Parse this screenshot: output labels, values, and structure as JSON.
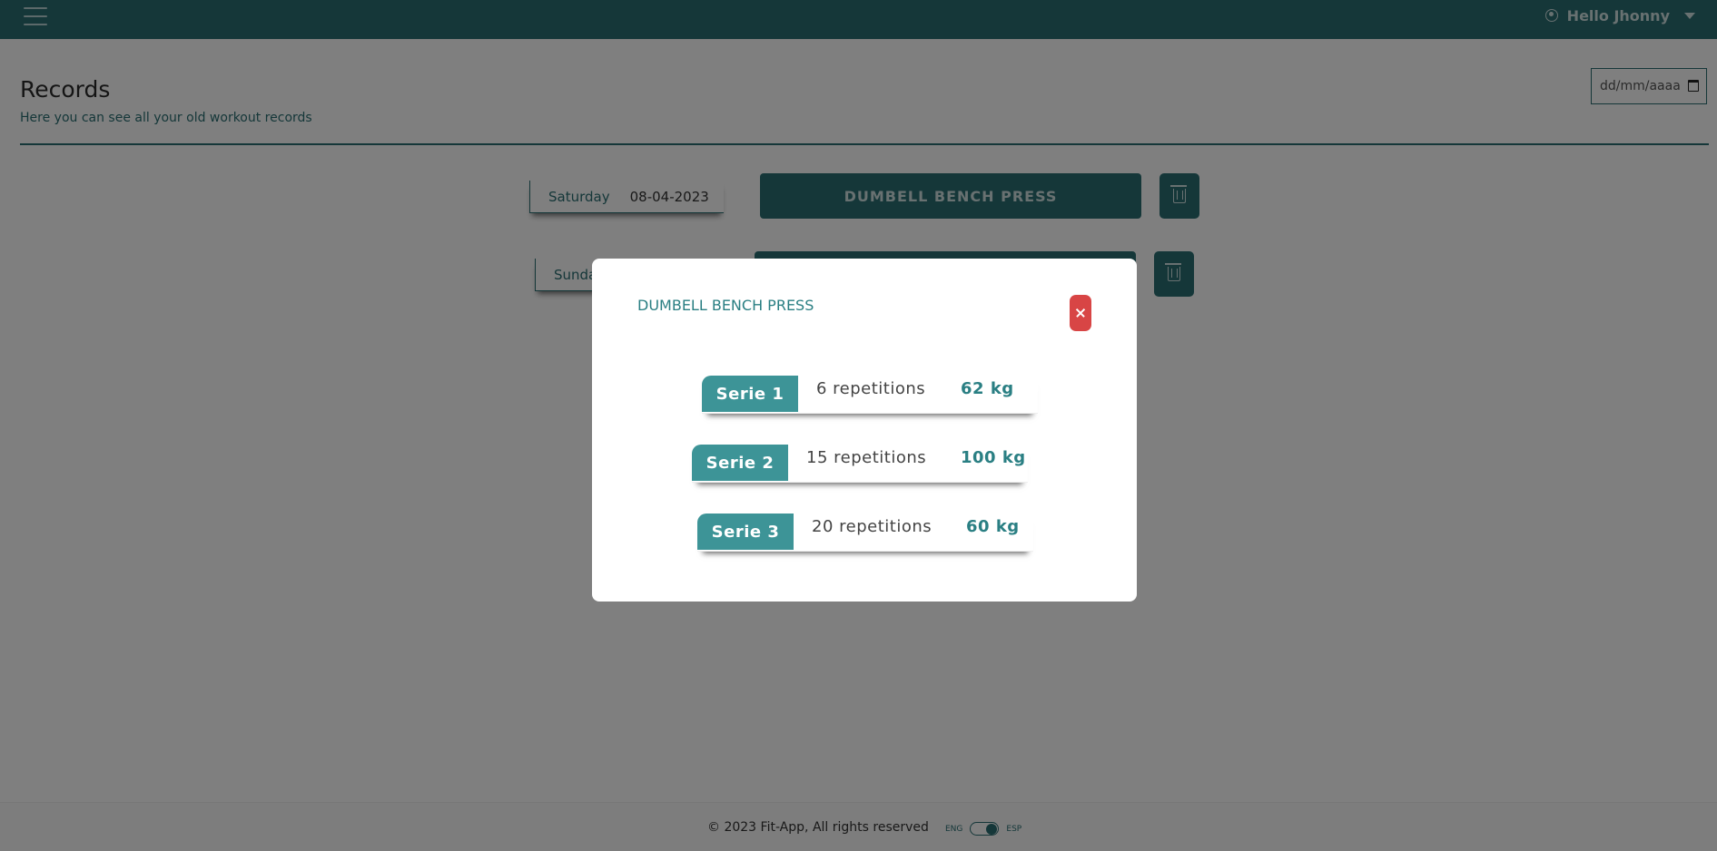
{
  "header": {
    "menu_icon": "hamburger-icon",
    "user_icon": "user-circle-icon",
    "user_greeting": "Hello Jhonny",
    "dropdown_icon": "caret-down-icon"
  },
  "page": {
    "title": "Records",
    "subtitle": "Here you can see all your old workout records",
    "date_filter_placeholder": "dd/mm/aaaa",
    "calendar_icon": "calendar-icon"
  },
  "records": [
    {
      "day": "Saturday",
      "date": "08-04-2023",
      "exercise": "DUMBELL BENCH PRESS",
      "delete_icon": "trash-icon"
    },
    {
      "day": "Sunda",
      "date": "",
      "exercise": "",
      "delete_icon": "trash-icon"
    }
  ],
  "modal": {
    "title": "DUMBELL BENCH PRESS",
    "close_icon": "close-icon",
    "series": [
      {
        "label": "Serie 1",
        "reps": "6 repetitions",
        "weight": "62 kg"
      },
      {
        "label": "Serie 2",
        "reps": "15 repetitions",
        "weight": "100 kg"
      },
      {
        "label": "Serie 3",
        "reps": "20 repetitions",
        "weight": "60 kg"
      }
    ]
  },
  "footer": {
    "copyright": "© 2023 Fit-App, All rights reserved",
    "lang_left": "ENG",
    "lang_right": "ESP",
    "toggle_state": "ESP"
  },
  "colors": {
    "primary": "#2a6f73",
    "serie_tag": "#3d9497",
    "close": "#d84545",
    "overlay": "rgba(0,0,0,0.5)"
  }
}
